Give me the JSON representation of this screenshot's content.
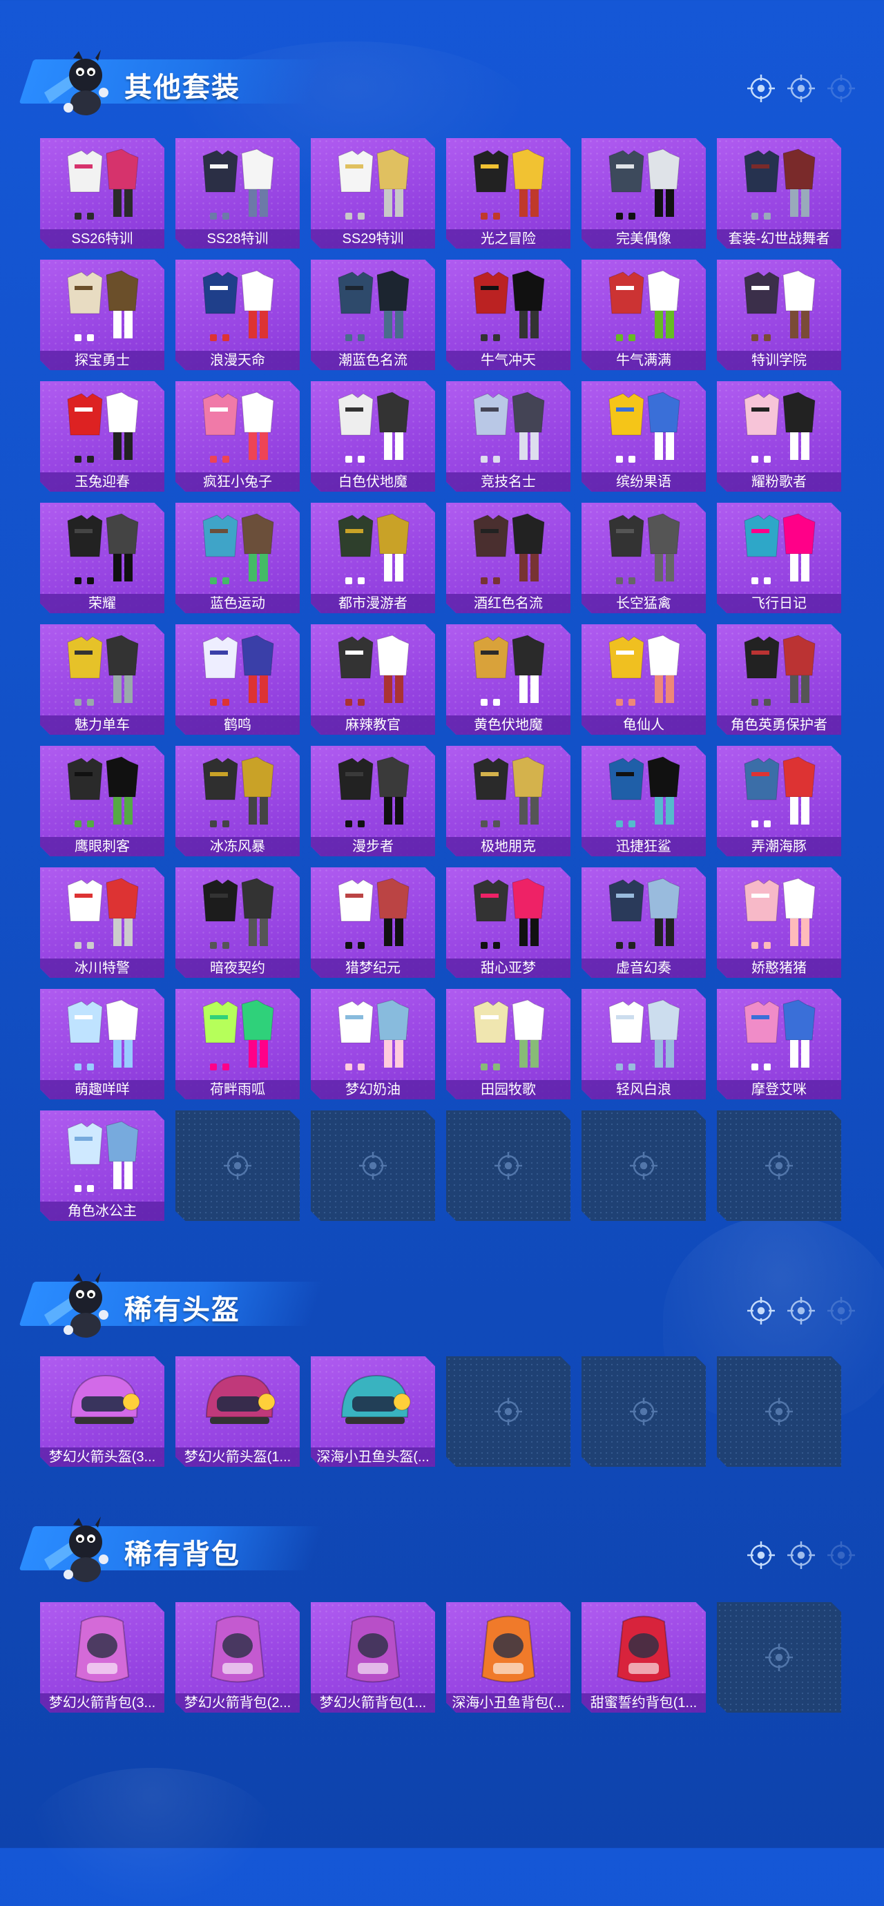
{
  "colors": {
    "background": "#1557d6",
    "card_purple": "#9a47e4",
    "card_empty": "#1f4174",
    "label_bar": "#5f23aa"
  },
  "sections": [
    {
      "title": "其他套装",
      "icon": "target-icon",
      "items": [
        "SS26特训",
        "SS28特训",
        "SS29特训",
        "光之冒险",
        "完美偶像",
        "套装-幻世战舞者",
        "探宝勇士",
        "浪漫天命",
        "潮蓝色名流",
        "牛气冲天",
        "牛气满满",
        "特训学院",
        "玉兔迎春",
        "疯狂小兔子",
        "白色伏地魔",
        "竞技名士",
        "缤纷果语",
        "耀粉歌者",
        "荣耀",
        "蓝色运动",
        "都市漫游者",
        "酒红色名流",
        "长空猛禽",
        "飞行日记",
        "魅力单车",
        "鹤鸣",
        "麻辣教官",
        "黄色伏地魔",
        "龟仙人",
        "角色英勇保护者",
        "鹰眼刺客",
        "冰冻风暴",
        "漫步者",
        "极地朋克",
        "迅捷狂鲨",
        "弄潮海豚",
        "冰川特警",
        "暗夜契约",
        "猎梦纪元",
        "甜心亚梦",
        "虚音幻奏",
        "娇憨猪猪",
        "萌趣咩咩",
        "荷畔雨呱",
        "梦幻奶油",
        "田园牧歌",
        "轻风白浪",
        "摩登艾咪",
        "角色冰公主"
      ],
      "empty_slots": 5
    },
    {
      "title": "稀有头盔",
      "icon": "target-icon",
      "items": [
        "梦幻火箭头盔(3...",
        "梦幻火箭头盔(1...",
        "深海小丑鱼头盔(..."
      ],
      "empty_slots": 3
    },
    {
      "title": "稀有背包",
      "icon": "target-icon",
      "items": [
        "梦幻火箭背包(3...",
        "梦幻火箭背包(2...",
        "梦幻火箭背包(1...",
        "深海小丑鱼背包(...",
        "甜蜜誓约背包(1..."
      ],
      "empty_slots": 1
    }
  ]
}
